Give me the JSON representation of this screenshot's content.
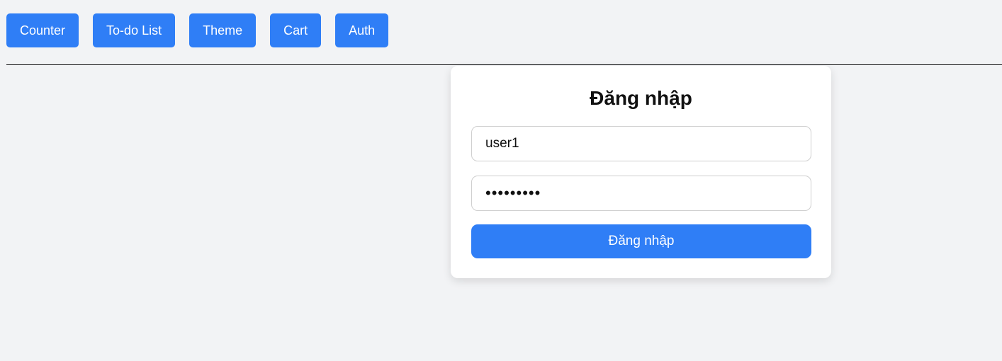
{
  "nav": {
    "items": [
      {
        "label": "Counter"
      },
      {
        "label": "To-do List"
      },
      {
        "label": "Theme"
      },
      {
        "label": "Cart"
      },
      {
        "label": "Auth"
      }
    ]
  },
  "login": {
    "title": "Đăng nhập",
    "username_value": "user1",
    "password_value": "•••••••••",
    "submit_label": "Đăng nhập"
  },
  "colors": {
    "accent": "#2f7ef6",
    "background": "#f2f3f5",
    "card": "#ffffff"
  }
}
